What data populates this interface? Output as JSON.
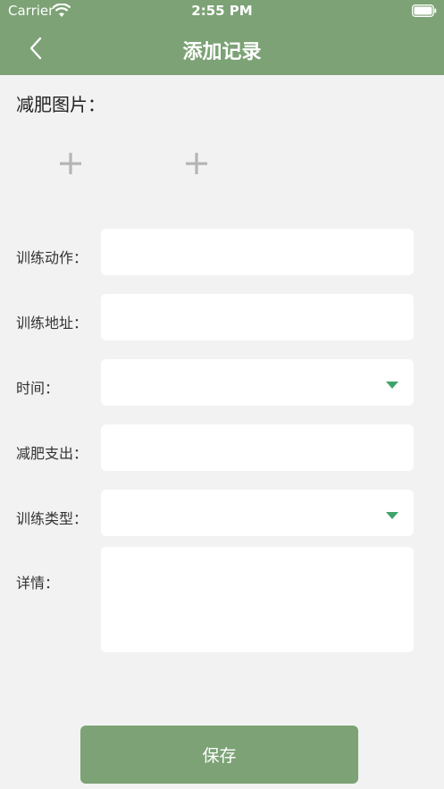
{
  "status_bar": {
    "carrier": "Carrier",
    "time": "2:55 PM"
  },
  "header": {
    "title": "添加记录"
  },
  "photos": {
    "label": "减肥图片："
  },
  "form": {
    "action_label": "训练动作：",
    "address_label": "训练地址：",
    "time_label": "时间：",
    "expense_label": "减肥支出：",
    "type_label": "训练类型：",
    "details_label": "详情："
  },
  "save_button": "保存",
  "colors": {
    "primary": "#7ca275",
    "accent": "#3fa46a",
    "background": "#f2f2f2"
  }
}
